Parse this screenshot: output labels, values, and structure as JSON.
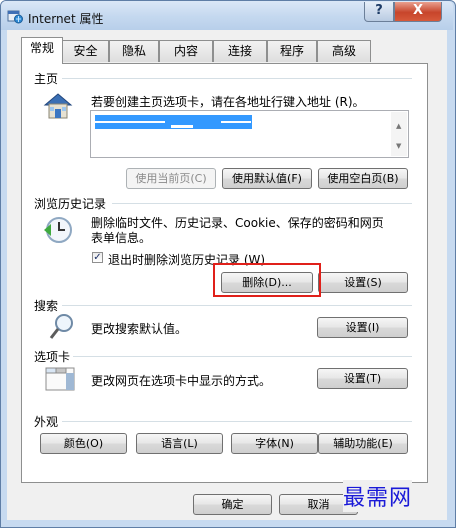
{
  "window": {
    "title": "Internet 属性",
    "help_label": "?",
    "close_label": "X"
  },
  "tabs": [
    {
      "label": "常规",
      "active": true
    },
    {
      "label": "安全",
      "active": false
    },
    {
      "label": "隐私",
      "active": false
    },
    {
      "label": "内容",
      "active": false
    },
    {
      "label": "连接",
      "active": false
    },
    {
      "label": "程序",
      "active": false
    },
    {
      "label": "高级",
      "active": false
    }
  ],
  "home": {
    "group_label": "主页",
    "description": "若要创建主页选项卡，请在各地址行键入地址 (R)。",
    "buttons": {
      "use_current": "使用当前页(C)",
      "use_default": "使用默认值(F)",
      "use_blank": "使用空白页(B)"
    }
  },
  "history": {
    "group_label": "浏览历史记录",
    "description_line1": "删除临时文件、历史记录、Cookie、保存的密码和网页",
    "description_line2": "表单信息。",
    "checkbox_label": "退出时删除浏览历史记录 (W)",
    "checkbox_checked": true,
    "delete_button": "删除(D)...",
    "settings_button": "设置(S)"
  },
  "search": {
    "group_label": "搜索",
    "description": "更改搜索默认值。",
    "settings_button": "设置(I)"
  },
  "tabs_group": {
    "group_label": "选项卡",
    "description": "更改网页在选项卡中显示的方式。",
    "settings_button": "设置(T)"
  },
  "appearance": {
    "group_label": "外观",
    "buttons": {
      "colors": "颜色(O)",
      "languages": "语言(L)",
      "fonts": "字体(N)",
      "accessibility": "辅助功能(E)"
    }
  },
  "footer": {
    "ok_button": "确定",
    "cancel_button": "取消"
  },
  "watermark": "最需网",
  "colors": {
    "highlight_box": "#e0201a",
    "selection": "#3399ff",
    "watermark": "#1a1ad8"
  }
}
